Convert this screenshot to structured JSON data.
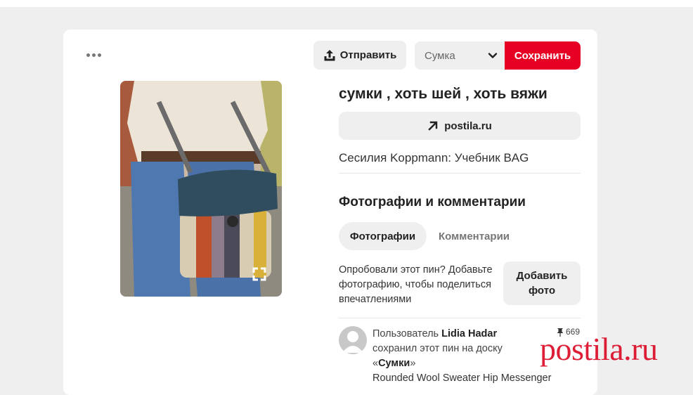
{
  "pin": {
    "title": "сумки , хоть шей , хоть вяжи",
    "source_domain": "postila.ru",
    "description": "Сесилия Koppmann: Учебник BAG"
  },
  "toolbar": {
    "send_label": "Отправить",
    "board_selected": "Сумка",
    "save_label": "Сохранить"
  },
  "comments_section": {
    "title": "Фотографии и комментарии",
    "tabs": [
      {
        "label": "Фотографии",
        "active": true
      },
      {
        "label": "Комментарии",
        "active": false
      }
    ],
    "prompt": "Опробовали этот пин? Добавьте фотографию, чтобы поделиться впечатлениями",
    "add_photo_line1": "Добавить",
    "add_photo_line2": "фото"
  },
  "activity": {
    "prefix": "Пользователь",
    "user": "Lidia Hadar",
    "action": "сохранил этот пин на доску",
    "quote_open": "«",
    "board": "Сумки",
    "quote_close": "»",
    "next_line_partial": "Rounded Wool Sweater Hip Messenger",
    "save_count": "669"
  },
  "watermark": "postila.ru",
  "colors": {
    "primary_red": "#e60023",
    "button_gray": "#efefef",
    "page_bg": "#efefef"
  },
  "icons": {
    "more": "more-dots-icon",
    "share": "share-upload-icon",
    "chevron": "chevron-down-icon",
    "link": "arrow-up-right-icon",
    "expand": "expand-corners-icon",
    "pin": "pushpin-icon"
  }
}
